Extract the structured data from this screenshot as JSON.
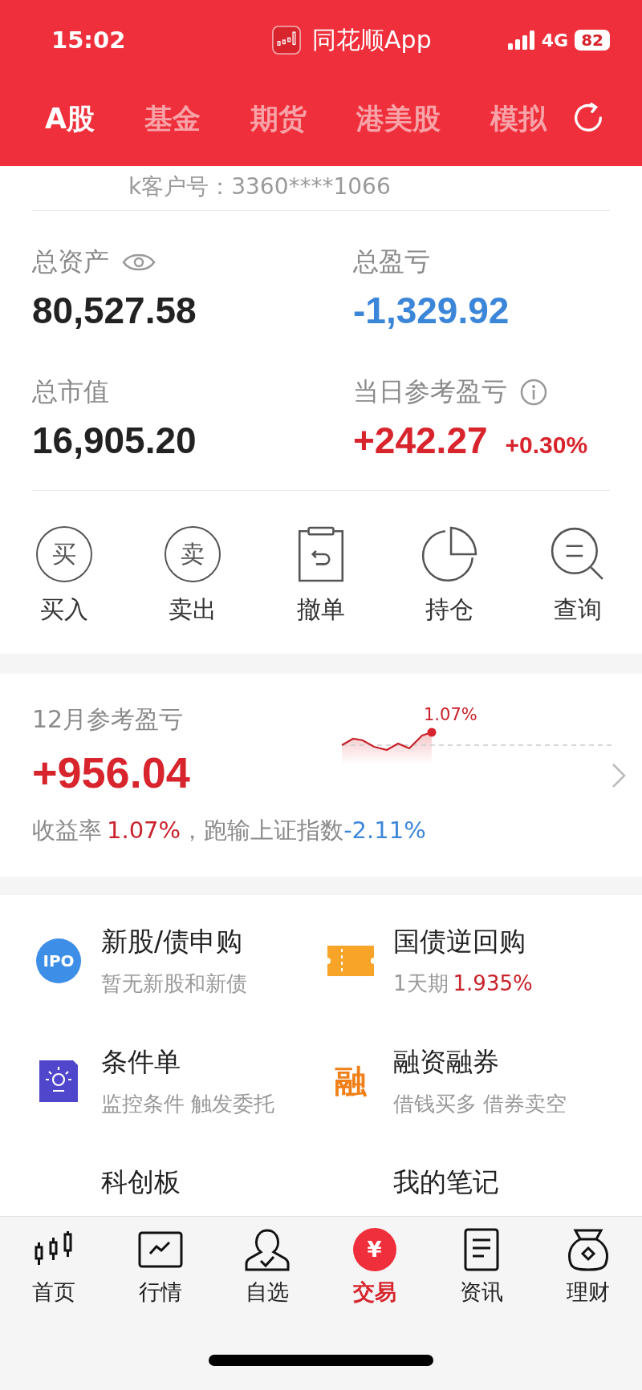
{
  "status_bar": {
    "time": "15:02",
    "app": "同花顺App",
    "network": "4G",
    "battery": "82"
  },
  "tabs": [
    {
      "label": "A股",
      "selected": true
    },
    {
      "label": "基金",
      "selected": false
    },
    {
      "label": "期货",
      "selected": false
    },
    {
      "label": "港美股",
      "selected": false
    },
    {
      "label": "模拟",
      "selected": false
    }
  ],
  "account": {
    "customer_id": "k客户号：3360****1066"
  },
  "summary": [
    {
      "label": "总资产",
      "value": "80,527.58",
      "color": "#222222",
      "kind": "eye"
    },
    {
      "label": "总盈亏",
      "value": "-1,329.92",
      "color": "#3c86d9",
      "kind": "plain"
    },
    {
      "label": "总市值",
      "value": "16,905.20",
      "color": "#222222",
      "kind": "plain"
    },
    {
      "label": "当日参考盈亏",
      "value": "+242.27",
      "color": "#d8242c",
      "kind": "info",
      "extra": "+0.30%"
    }
  ],
  "actions": [
    {
      "label": "买入",
      "kind": "glyph",
      "glyph": "买"
    },
    {
      "label": "卖出",
      "kind": "glyph",
      "glyph": "卖"
    },
    {
      "label": "撤单",
      "kind": "clipboard"
    },
    {
      "label": "持仓",
      "kind": "pie"
    },
    {
      "label": "查询",
      "kind": "search"
    }
  ],
  "monthly": {
    "title": "12月参考盈亏",
    "value": "+956.04",
    "chart_label": "1.07%",
    "rate_label": "收益率",
    "rate": "1.07%",
    "compare_label": "，跑输上证指数",
    "compare": "-2.11%"
  },
  "services": [
    {
      "title": "新股/债申购",
      "subtitle": "暂无新股和新债",
      "kind": "ipo",
      "glyph": "IPO"
    },
    {
      "title": "国债逆回购",
      "subtitle": "1天期",
      "highlight": "1.935%",
      "kind": "ticket"
    },
    {
      "title": "条件单",
      "subtitle": "监控条件 触发委托",
      "kind": "lamp"
    },
    {
      "title": "融资融券",
      "subtitle": "借钱买多 借券卖空",
      "kind": "glyph",
      "glyph": "融"
    },
    {
      "title": "科创板",
      "kind": "none"
    },
    {
      "title": "我的笔记",
      "kind": "none"
    }
  ],
  "nav": [
    {
      "label": "首页",
      "kind": "candles",
      "selected": false
    },
    {
      "label": "行情",
      "kind": "chart",
      "selected": false
    },
    {
      "label": "自选",
      "kind": "person",
      "selected": false
    },
    {
      "label": "交易",
      "kind": "yen",
      "glyph": "¥",
      "selected": true
    },
    {
      "label": "资讯",
      "kind": "doc",
      "selected": false
    },
    {
      "label": "理财",
      "kind": "bag",
      "selected": false
    }
  ]
}
